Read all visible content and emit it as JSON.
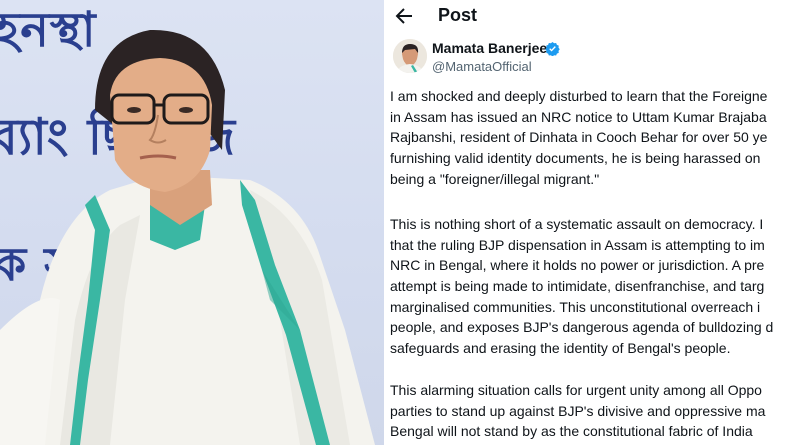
{
  "photo": {
    "banner_lines": [
      "হনস্থা",
      "ব্যাং ছিত জ",
      "ক স"
    ]
  },
  "post": {
    "header": {
      "back_icon": "arrow-left-icon",
      "title": "Post"
    },
    "author": {
      "name": "Mamata Banerjee",
      "handle": "@MamataOfficial",
      "verified_icon": "verified-badge-icon",
      "verified_color": "#1d9bf0"
    },
    "paragraphs": [
      {
        "lines": [
          "I am shocked and deeply disturbed to learn that the Foreigne",
          "in Assam has issued an NRC notice to Uttam Kumar Brajaba",
          "Rajbanshi, resident of Dinhata in Cooch Behar for over 50 ye",
          "furnishing valid identity documents, he is being harassed on",
          "being a \"foreigner/illegal migrant.\""
        ]
      },
      {
        "lines": [
          "This is nothing short of a systematic assault on democracy. I",
          "that the ruling BJP dispensation in Assam is attempting to im",
          "NRC in Bengal, where it holds no power or jurisdiction. A pre",
          "attempt is being made to intimidate, disenfranchise, and targ",
          "marginalised communities. This unconstitutional overreach i",
          "people, and exposes BJP's dangerous agenda of bulldozing d",
          "safeguards and erasing the identity of Bengal's people."
        ]
      },
      {
        "lines": [
          "This alarming situation calls for urgent unity among all Oppo",
          "parties to stand up against BJP's divisive and oppressive ma",
          "Bengal will not stand by as the constitutional fabric of India"
        ]
      }
    ]
  },
  "colors": {
    "banner_text": "#2a3f8f",
    "text": "#0f1419",
    "muted": "#536471",
    "accent": "#1d9bf0"
  }
}
